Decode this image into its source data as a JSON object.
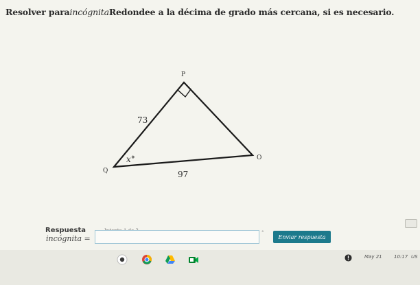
{
  "question": {
    "part1": "Resolver para",
    "variable": "incógnita",
    "part2": "Redondee a la décima de grado más cercana, si es necesario."
  },
  "figure": {
    "vertices": {
      "top": "P",
      "left": "Q",
      "right": "O"
    },
    "side_qp": "73",
    "side_qo": "97",
    "angle_q": "x°"
  },
  "answer": {
    "label": "Respuesta",
    "attempt": "Intento 1 de 2",
    "variable_label": "incógnita =",
    "input_value": "",
    "unit": "°",
    "submit_label": "Enviar respuesta"
  },
  "taskbar": {
    "date": "May 21",
    "time": "10:17",
    "locale": "US",
    "icons": [
      "circle-app-icon",
      "browser-icon",
      "drive-icon",
      "meet-icon"
    ],
    "notification_icon": "notification-icon"
  }
}
